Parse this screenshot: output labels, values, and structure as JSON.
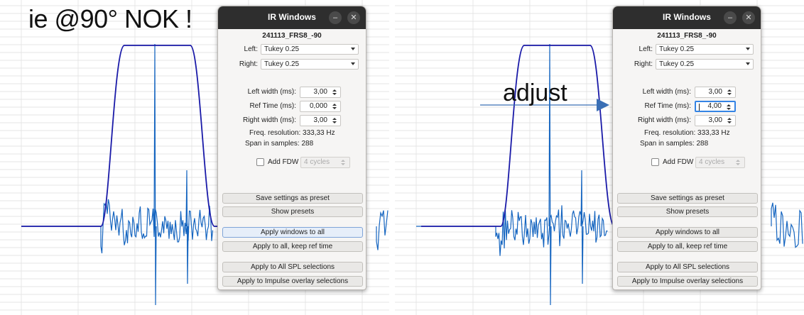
{
  "left_panel": {
    "headline": "ie @90° NOK !",
    "window": {
      "title": "IR Windows",
      "filename": "241113_FRS8_-90",
      "left": {
        "label": "Left:",
        "value": "Tukey 0.25"
      },
      "right": {
        "label": "Right:",
        "value": "Tukey 0.25"
      },
      "left_width": {
        "label": "Left width (ms):",
        "value": "3,00"
      },
      "ref_time": {
        "label": "Ref Time (ms):",
        "value": "0,000"
      },
      "right_width": {
        "label": "Right width (ms):",
        "value": "3,00"
      },
      "freq_res": "Freq. resolution: 333,33 Hz",
      "span": "Span in samples: 288",
      "fdw": {
        "label": "Add FDW",
        "value": "4 cycles"
      },
      "buttons": {
        "save": "Save settings as preset",
        "show": "Show presets",
        "apply_all": "Apply windows to all",
        "apply_keep": "Apply to all, keep ref time",
        "apply_spl": "Apply to All SPL selections",
        "apply_impulse": "Apply to Impulse overlay selections"
      }
    }
  },
  "right_panel": {
    "annotation": "adjust",
    "window": {
      "title": "IR Windows",
      "filename": "241113_FRS8_-90",
      "left": {
        "label": "Left:",
        "value": "Tukey 0.25"
      },
      "right": {
        "label": "Right:",
        "value": "Tukey 0.25"
      },
      "left_width": {
        "label": "Left width (ms):",
        "value": "3,00"
      },
      "ref_time": {
        "label": "Ref Time (ms):",
        "value": "4,00"
      },
      "right_width": {
        "label": "Right width (ms):",
        "value": "3,00"
      },
      "freq_res": "Freq. resolution: 333,33 Hz",
      "span": "Span in samples: 288",
      "fdw": {
        "label": "Add FDW",
        "value": "4 cycles"
      },
      "buttons": {
        "save": "Save settings as preset",
        "show": "Show presets",
        "apply_all": "Apply windows to all",
        "apply_keep": "Apply to all, keep ref time",
        "apply_spl": "Apply to All SPL selections",
        "apply_impulse": "Apply to Impulse overlay selections"
      }
    }
  },
  "colors": {
    "trace": "#1565c0",
    "window": "#1a1aa8",
    "grid": "#d8d8d8",
    "accent": "#3584e4"
  }
}
